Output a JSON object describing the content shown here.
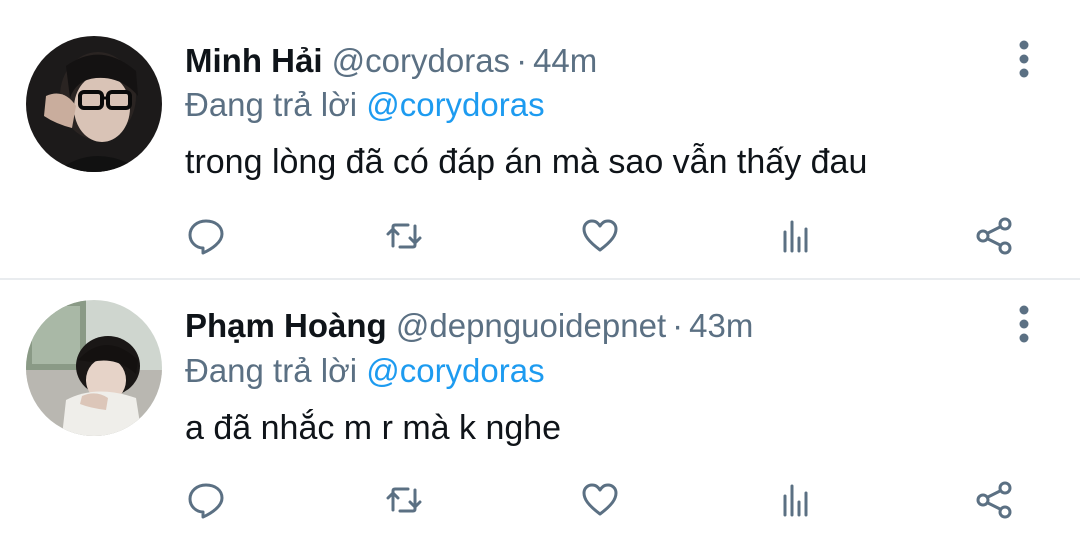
{
  "tweets": [
    {
      "name": "Minh Hải",
      "handle": "@corydoras",
      "separator": "·",
      "time": "44m",
      "reply_prefix": "Đang trả lời",
      "reply_to": "@corydoras",
      "text": "trong lòng đã có đáp án mà sao vẫn thấy đau"
    },
    {
      "name": "Phạm Hoàng",
      "handle": "@depnguoidepnet",
      "separator": "·",
      "time": "43m",
      "reply_prefix": "Đang trả lời",
      "reply_to": "@corydoras",
      "text": "a đã nhắc m r mà k nghe"
    }
  ],
  "icons": {
    "reply": "reply-icon",
    "retweet": "retweet-icon",
    "like": "heart-icon",
    "stats": "analytics-icon",
    "share": "share-icon",
    "more": "more-vertical-icon"
  },
  "colors": {
    "text": "#0f1419",
    "muted": "#5b7083",
    "mention": "#1d9bf0",
    "divider": "#e9ecef"
  }
}
